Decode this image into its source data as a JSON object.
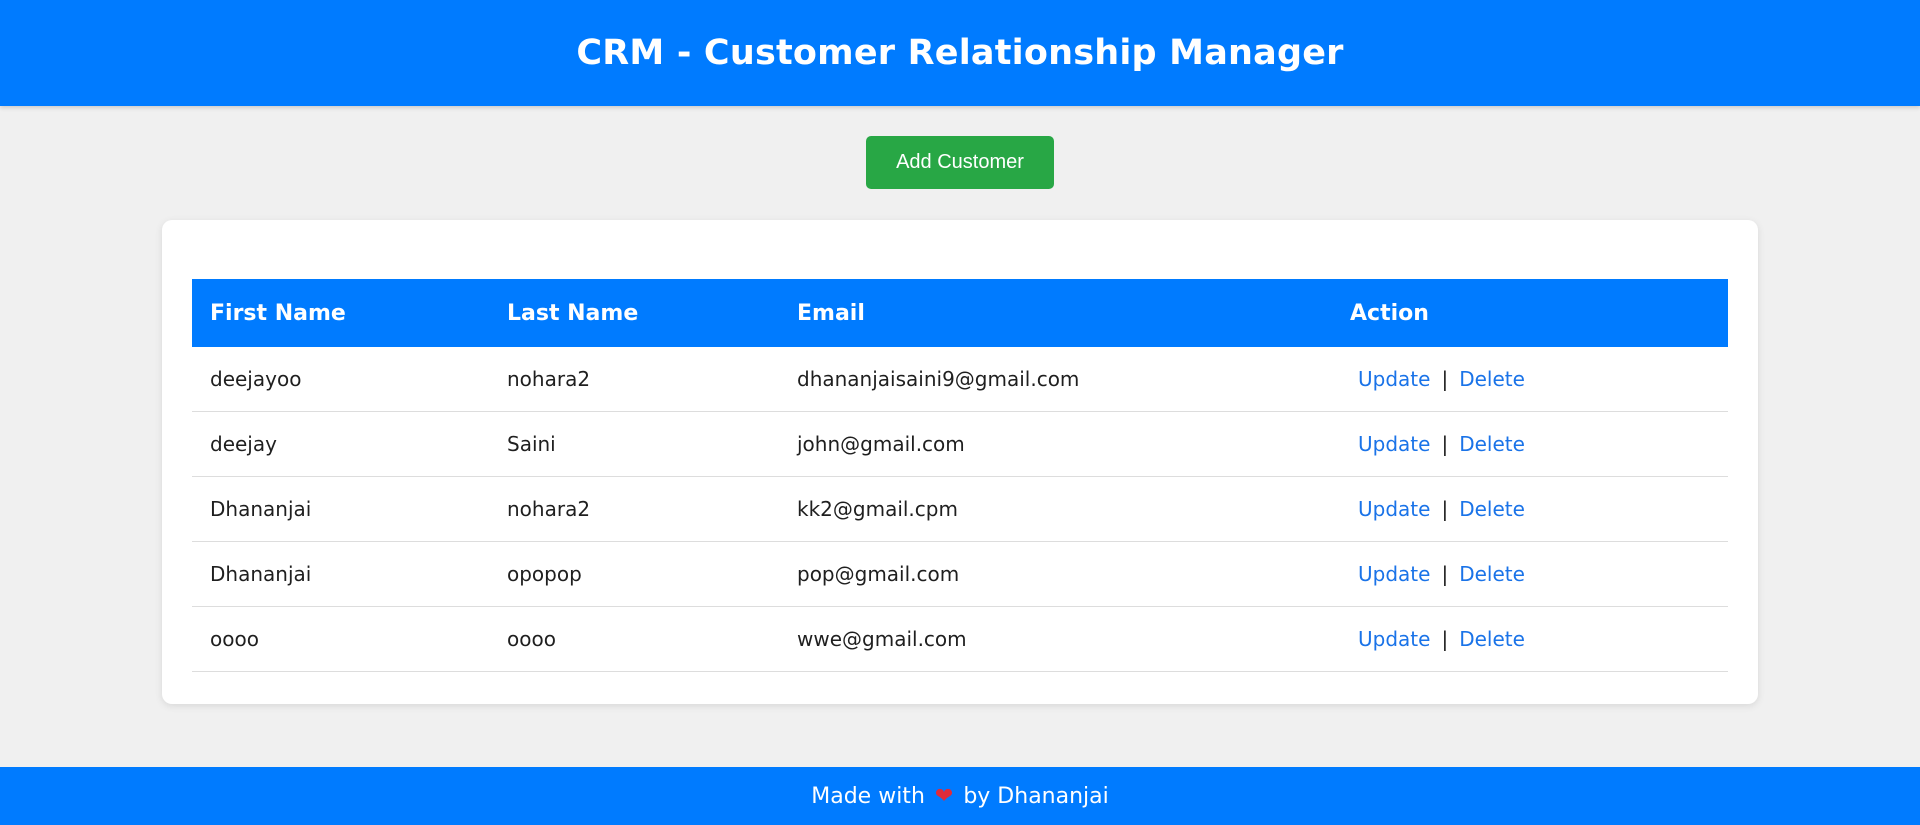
{
  "header": {
    "title": "CRM - Customer Relationship Manager"
  },
  "toolbar": {
    "add_label": "Add Customer"
  },
  "table": {
    "columns": [
      "First Name",
      "Last Name",
      "Email",
      "Action"
    ],
    "rows": [
      {
        "first": "deejayoo",
        "last": "nohara2",
        "email": "dhananjaisaini9@gmail.com",
        "update": "Update",
        "sep": "|",
        "delete": "Delete"
      },
      {
        "first": "deejay",
        "last": "Saini",
        "email": "john@gmail.com",
        "update": "Update",
        "sep": "|",
        "delete": "Delete"
      },
      {
        "first": "Dhananjai",
        "last": "nohara2",
        "email": "kk2@gmail.cpm",
        "update": "Update",
        "sep": "|",
        "delete": "Delete"
      },
      {
        "first": "Dhananjai",
        "last": "opopop",
        "email": "pop@gmail.com",
        "update": "Update",
        "sep": "|",
        "delete": "Delete"
      },
      {
        "first": "oooo",
        "last": "oooo",
        "email": "wwe@gmail.com",
        "update": "Update",
        "sep": "|",
        "delete": "Delete"
      }
    ]
  },
  "footer": {
    "made_with": "Made with",
    "heart_icon": "heart-icon",
    "by": "by Dhananjai"
  },
  "colors": {
    "primary": "#007bff",
    "success": "#28a745",
    "link": "#1a73e8",
    "background": "#f0f0f0"
  }
}
